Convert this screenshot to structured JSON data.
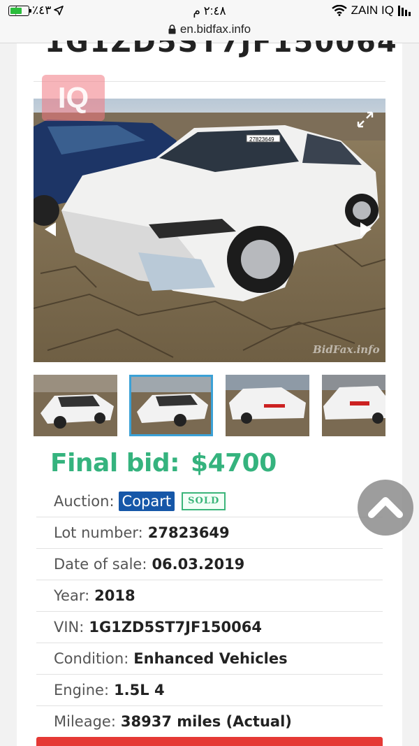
{
  "status_bar": {
    "battery_percent": "٪٤٣",
    "time": "٢:٤٨ م",
    "carrier": "ZAIN IQ"
  },
  "browser": {
    "url": "en.bidfax.info"
  },
  "page": {
    "cut_title": "1G1ZD5ST7JF150064",
    "logo_text": "IQ",
    "watermark": "BidFax.info",
    "plate_text": "27823649"
  },
  "listing": {
    "final_bid_label": "Final bid:",
    "final_bid_value": "$4700",
    "auction_label": "Auction:",
    "auction_value": "Copart",
    "sold_badge": "SOLD",
    "lot_label": "Lot number:",
    "lot_value": "27823649",
    "date_label": "Date of sale:",
    "date_value": "06.03.2019",
    "year_label": "Year:",
    "year_value": "2018",
    "vin_label": "VIN:",
    "vin_value": "1G1ZD5ST7JF150064",
    "condition_label": "Condition:",
    "condition_value": "Enhanced Vehicles",
    "engine_label": "Engine:",
    "engine_value": "1.5L 4",
    "mileage_label": "Mileage:",
    "mileage_value": "38937 miles (Actual)"
  },
  "colors": {
    "accent_green": "#35b37e",
    "copart_blue": "#1657a8",
    "thumb_active": "#3ba1d6",
    "button_red": "#e53935"
  },
  "icons": [
    "wifi-icon",
    "signal-icon",
    "battery-icon",
    "charging-icon",
    "location-arrow-icon",
    "lock-icon",
    "expand-icon",
    "arrow-left-icon",
    "arrow-right-icon",
    "chevron-up-icon"
  ]
}
